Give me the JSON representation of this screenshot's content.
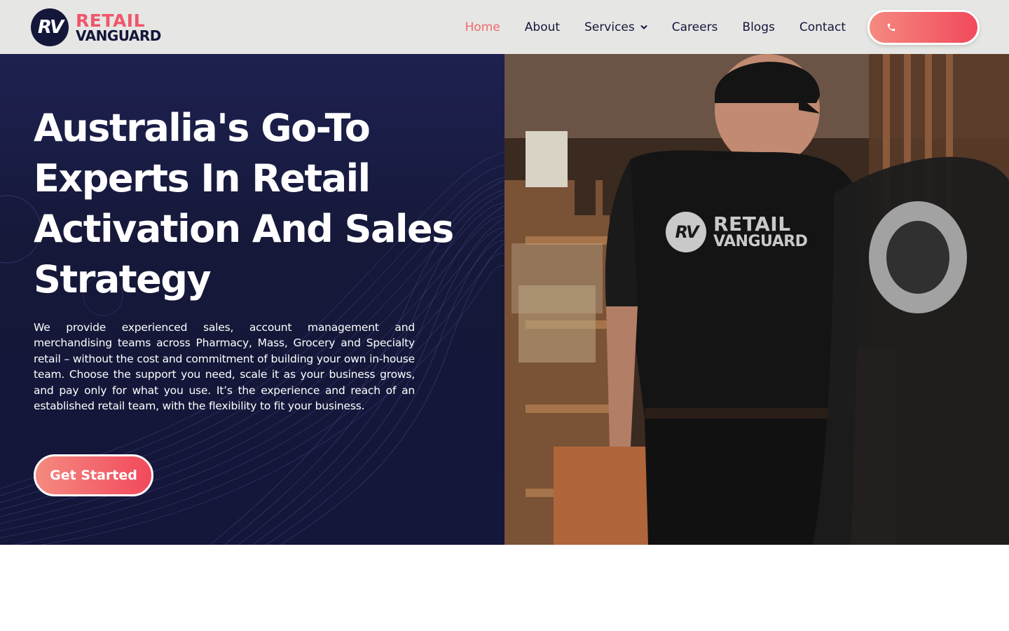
{
  "brand": {
    "logo_mark": "RV",
    "name_line1": "RETAIL",
    "name_line2": "VANGUARD"
  },
  "nav": {
    "items": [
      {
        "label": "Home",
        "active": true
      },
      {
        "label": "About",
        "active": false
      },
      {
        "label": "Services",
        "active": false,
        "has_dropdown": true
      },
      {
        "label": "Careers",
        "active": false
      },
      {
        "label": "Blogs",
        "active": false
      },
      {
        "label": "Contact",
        "active": false
      }
    ],
    "call_button_icon": "phone-icon"
  },
  "hero": {
    "headline": "Australia's Go-To Experts In Retail Activation And Sales Strategy",
    "description": "We provide experienced sales, account management and merchandising teams across Pharmacy, Mass, Grocery and Specialty retail – without the cost and commitment of building your own in-house team. Choose the support you need, scale it as your business grows, and pay only for what you use. It’s the experience and reach of an established retail team, with the flexibility to fit your business.",
    "cta_label": "Get Started",
    "shirt_logo_mark": "RV",
    "shirt_logo_line1": "RETAIL",
    "shirt_logo_line2": "VANGUARD"
  },
  "colors": {
    "accent": "#f2495c",
    "accent_light": "#f48a80",
    "navy": "#14163a",
    "header_bg": "#e6e6e4"
  }
}
